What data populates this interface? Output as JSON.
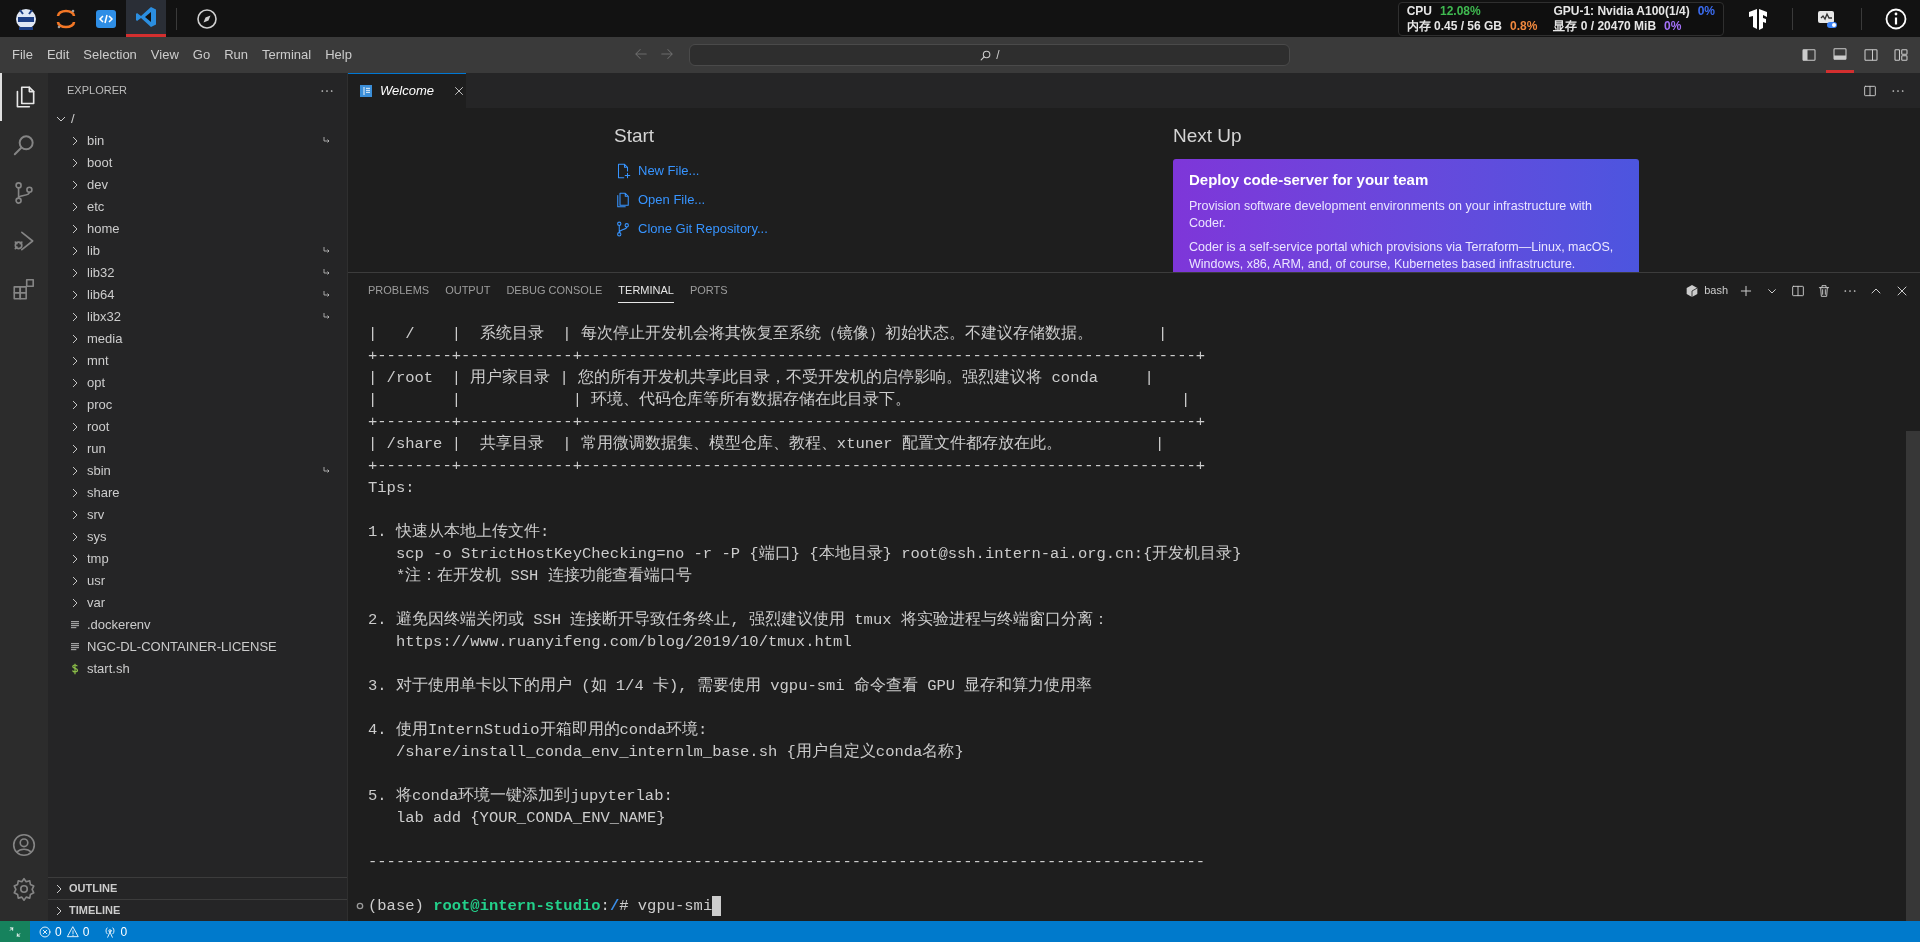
{
  "top_bar": {
    "apps": [
      {
        "kind": "mascot",
        "selected": false
      },
      {
        "kind": "arcs",
        "selected": false
      },
      {
        "kind": "code",
        "selected": false
      },
      {
        "kind": "editor",
        "selected": true
      },
      {
        "kind": "compass",
        "selected": false
      }
    ],
    "stats": [
      {
        "label": "CPU",
        "value": "12.08%",
        "color": "#3fb950"
      },
      {
        "label": "GPU-1: Nvidia A100(1/4)",
        "value": "0%",
        "color": "#3b6cf0"
      },
      {
        "label": "内存 0.45 / 56 GB",
        "value": "0.8%",
        "color": "#f0883e"
      },
      {
        "label": "显存 0 / 20470 MiB",
        "value": "0%",
        "color": "#a371f7"
      }
    ],
    "tools": [
      {
        "kind": "logo"
      },
      {
        "kind": "monitor"
      },
      {
        "kind": "info"
      }
    ]
  },
  "menu_bar": {
    "items": [
      "File",
      "Edit",
      "Selection",
      "View",
      "Go",
      "Run",
      "Terminal",
      "Help"
    ],
    "nav": [
      {
        "kind": "back",
        "disabled": true
      },
      {
        "kind": "forward",
        "disabled": true
      }
    ],
    "search": {
      "value": "/"
    },
    "layout_toggles": [
      {
        "kind": "primary-sidebar",
        "selected": false
      },
      {
        "kind": "panel",
        "selected": true
      },
      {
        "kind": "secondary-sidebar",
        "selected": false
      },
      {
        "kind": "customize",
        "selected": false
      }
    ]
  },
  "activity_bar": {
    "items": [
      {
        "kind": "explorer",
        "selected": true
      },
      {
        "kind": "search",
        "selected": false
      },
      {
        "kind": "source-control",
        "selected": false
      },
      {
        "kind": "run-debug",
        "selected": false
      },
      {
        "kind": "extensions",
        "selected": false
      }
    ],
    "bottom": [
      {
        "kind": "account"
      },
      {
        "kind": "settings"
      }
    ]
  },
  "sidebar": {
    "title": "EXPLORER",
    "tree": {
      "label": "/",
      "expanded": true,
      "children": [
        {
          "label": "bin",
          "kind": "folder",
          "symlink": true
        },
        {
          "label": "boot",
          "kind": "folder",
          "symlink": false
        },
        {
          "label": "dev",
          "kind": "folder",
          "symlink": false
        },
        {
          "label": "etc",
          "kind": "folder",
          "symlink": false
        },
        {
          "label": "home",
          "kind": "folder",
          "symlink": false
        },
        {
          "label": "lib",
          "kind": "folder",
          "symlink": true
        },
        {
          "label": "lib32",
          "kind": "folder",
          "symlink": true
        },
        {
          "label": "lib64",
          "kind": "folder",
          "symlink": true
        },
        {
          "label": "libx32",
          "kind": "folder",
          "symlink": true
        },
        {
          "label": "media",
          "kind": "folder",
          "symlink": false
        },
        {
          "label": "mnt",
          "kind": "folder",
          "symlink": false
        },
        {
          "label": "opt",
          "kind": "folder",
          "symlink": false
        },
        {
          "label": "proc",
          "kind": "folder",
          "symlink": false
        },
        {
          "label": "root",
          "kind": "folder",
          "symlink": false
        },
        {
          "label": "run",
          "kind": "folder",
          "symlink": false
        },
        {
          "label": "sbin",
          "kind": "folder",
          "symlink": true
        },
        {
          "label": "share",
          "kind": "folder",
          "symlink": false
        },
        {
          "label": "srv",
          "kind": "folder",
          "symlink": false
        },
        {
          "label": "sys",
          "kind": "folder",
          "symlink": false
        },
        {
          "label": "tmp",
          "kind": "folder",
          "symlink": false
        },
        {
          "label": "usr",
          "kind": "folder",
          "symlink": false
        },
        {
          "label": "var",
          "kind": "folder",
          "symlink": false
        },
        {
          "label": ".dockerenv",
          "kind": "file",
          "symlink": false
        },
        {
          "label": "NGC-DL-CONTAINER-LICENSE",
          "kind": "file",
          "symlink": false
        },
        {
          "label": "start.sh",
          "kind": "shell",
          "symlink": false
        }
      ]
    },
    "sections": [
      {
        "title": "OUTLINE",
        "expanded": false
      },
      {
        "title": "TIMELINE",
        "expanded": false
      }
    ]
  },
  "editor": {
    "tabs": [
      {
        "title": "Welcome",
        "selected": true
      }
    ],
    "welcome": {
      "start": {
        "heading": "Start",
        "actions": [
          {
            "kind": "new-file",
            "label": "New File..."
          },
          {
            "kind": "open-file",
            "label": "Open File..."
          },
          {
            "kind": "clone",
            "label": "Clone Git Repository..."
          }
        ]
      },
      "next_up": {
        "heading": "Next Up",
        "card": {
          "title": "Deploy code-server for your team",
          "paragraphs": [
            "Provision software development environments on your infrastructure with Coder.",
            "Coder is a self-service portal which provisions via Terraform—Linux, macOS, Windows, x86, ARM, and, of course, Kubernetes based infrastructure."
          ]
        }
      }
    }
  },
  "panel": {
    "tabs": [
      {
        "label": "PROBLEMS",
        "selected": false
      },
      {
        "label": "OUTPUT",
        "selected": false
      },
      {
        "label": "DEBUG CONSOLE",
        "selected": false
      },
      {
        "label": "TERMINAL",
        "selected": true
      },
      {
        "label": "PORTS",
        "selected": false
      }
    ],
    "terminal": {
      "name": "bash",
      "blocks": [
        [
          "|   /    |  系统目录  | 每次停止开发机会将其恢复至系统（镜像）初始状态。不建议存储数据。       |",
          "+--------+------------+------------------------------------------------------------------+",
          "| /root  | 用户家目录 | 您的所有开发机共享此目录，不受开发机的启停影响。强烈建议将 conda     |",
          "|        |            | 环境、代码仓库等所有数据存储在此目录下。                             |",
          "+--------+------------+------------------------------------------------------------------+",
          "| /share |  共享目录  | 常用微调数据集、模型仓库、教程、xtuner 配置文件都存放在此。          |",
          "+--------+------------+------------------------------------------------------------------+",
          "Tips:"
        ],
        [
          "1. 快速从本地上传文件:",
          "   scp -o StrictHostKeyChecking=no -r -P {端口} {本地目录} root@ssh.intern-ai.org.cn:{开发机目录}",
          "   *注：在开发机 SSH 连接功能查看端口号"
        ],
        [
          "2. 避免因终端关闭或 SSH 连接断开导致任务终止, 强烈建议使用 tmux 将实验进程与终端窗口分离：",
          "   https://www.ruanyifeng.com/blog/2019/10/tmux.html"
        ],
        [
          "3. 对于使用单卡以下的用户 (如 1/4 卡), 需要使用 vgpu-smi 命令查看 GPU 显存和算力使用率"
        ],
        [
          "4. 使用InternStudio开箱即用的conda环境:",
          "   /share/install_conda_env_internlm_base.sh {用户自定义conda名称}"
        ],
        [
          "5. 将conda环境一键添加到jupyterlab:",
          "   lab add {YOUR_CONDA_ENV_NAME}"
        ],
        [
          "------------------------------------------------------------------------------------------"
        ]
      ],
      "prompt": [
        {
          "kind": "plain",
          "text": "(base) "
        },
        {
          "kind": "user",
          "text": "root@intern-studio"
        },
        {
          "kind": "plain",
          "text": ":"
        },
        {
          "kind": "path",
          "text": "/"
        },
        {
          "kind": "plain",
          "text": "# vgpu-smi"
        }
      ]
    }
  },
  "status_bar": {
    "items": [
      {
        "kind": "errors",
        "text": "0"
      },
      {
        "kind": "warnings",
        "text": "0"
      },
      {
        "kind": "ports",
        "text": "0"
      }
    ]
  }
}
